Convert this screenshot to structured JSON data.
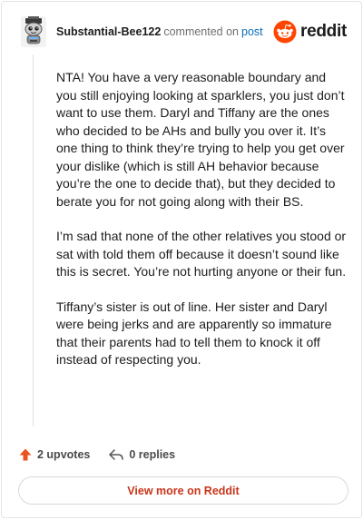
{
  "comment": {
    "username": "Substantial-Bee122",
    "commented_on_text": "commented on",
    "post_link_text": "post",
    "brand_name": "reddit",
    "paragraphs": [
      "NTA! You have a very reasonable boundary and you still enjoying looking at sparklers, you just don’t want to use them. Daryl and Tiffany are the ones who decided to be AHs and bully you over it. It’s one thing to think they’re trying to help you get over your dislike (which is still AH behavior because you’re the one to decide that), but they decided to berate you for not going along with their BS.",
      "I’m sad that none of the other relatives you stood or sat with told them off because it doesn’t sound like this is secret. You’re not hurting anyone or their fun.",
      "Tiffany’s sister is out of line. Her sister and Daryl were being jerks and are apparently so immature that their parents had to tell them to knock it off instead of respecting you."
    ],
    "upvotes_label": "2 upvotes",
    "replies_label": "0 replies",
    "view_more_label": "View more on Reddit"
  },
  "colors": {
    "brand_orange": "#ff4500",
    "upvote_orange": "#e8531e",
    "link_blue": "#0a6ebd",
    "view_more_red": "#c9341a"
  },
  "icons": {
    "avatar": "snoo-avatar",
    "brand": "reddit-snoo-icon",
    "upvote": "upvote-arrow-icon",
    "reply": "reply-arrow-icon"
  }
}
